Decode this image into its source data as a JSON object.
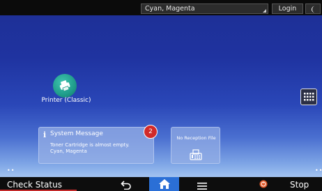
{
  "topbar": {
    "status_text": "Cyan, Magenta",
    "login_label": "Login",
    "energy_icon": "crescent-moon-icon"
  },
  "apps": {
    "printer": {
      "label": "Printer (Classic)",
      "icon": "printer-icon",
      "color": "#1f9c8a"
    }
  },
  "widgets": {
    "system_message": {
      "title": "System Message",
      "line1": "Toner Cartridge is almost empty.",
      "line2": "Cyan, Magenta",
      "badge_count": "2",
      "badge_color": "#d12a2a"
    },
    "reception": {
      "title": "No Reception File",
      "icon": "fax-machine-icon"
    }
  },
  "bottombar": {
    "check_status_label": "Check Status",
    "stop_label": "Stop",
    "home_color": "#2b6fd6",
    "stop_color": "#e25a2a"
  }
}
